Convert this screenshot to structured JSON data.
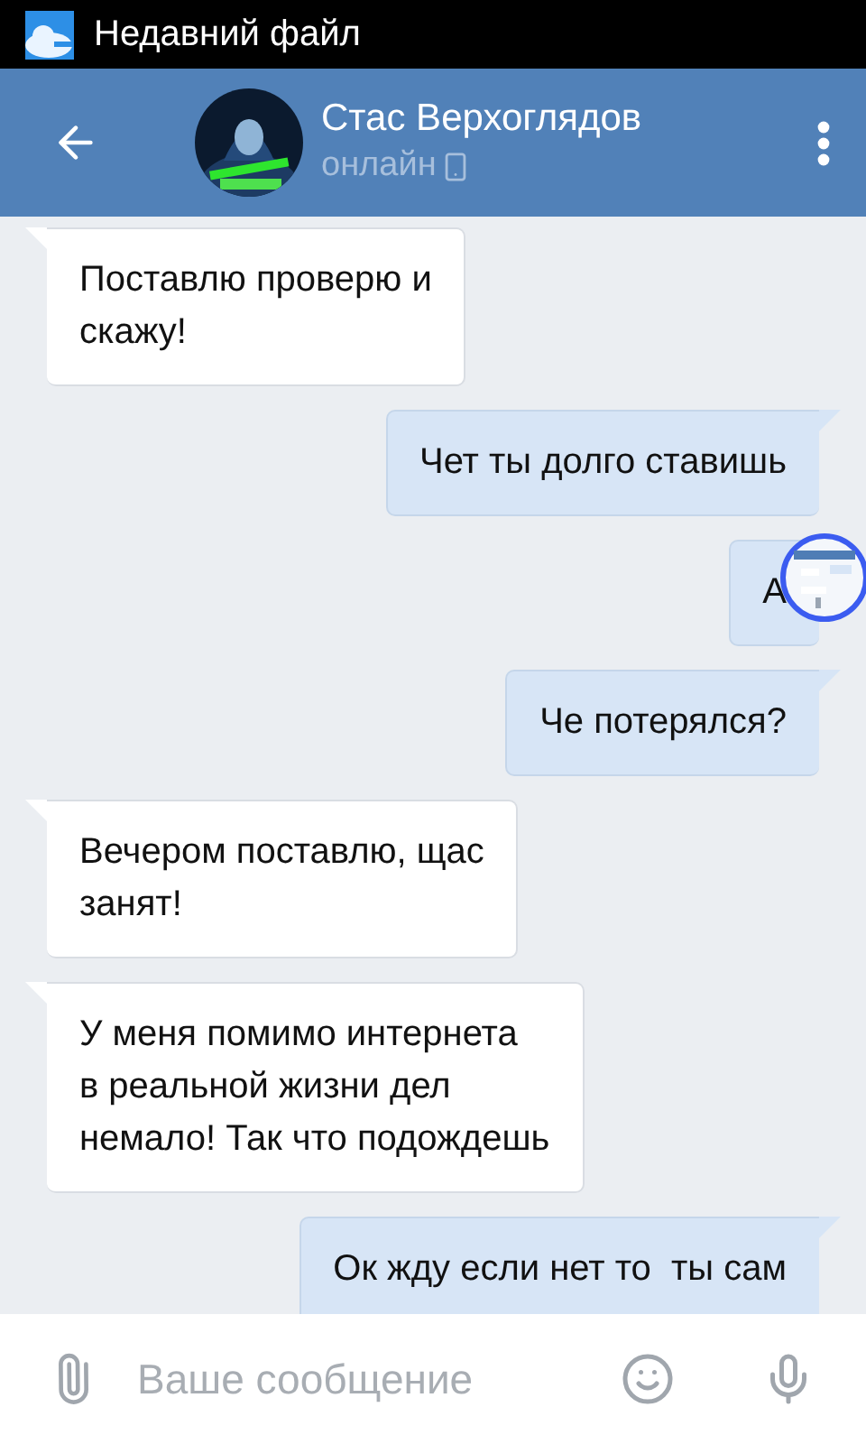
{
  "status_bar": {
    "notification": "Недавний файл"
  },
  "header": {
    "name": "Стас Верхоглядов",
    "status": "онлайн"
  },
  "messages": [
    {
      "text": "Поставлю проверю и\nскажу!",
      "outgoing": false
    },
    {
      "text": "Чет ты долго ставишь",
      "outgoing": true
    },
    {
      "text": "А",
      "outgoing": true,
      "overlay": true
    },
    {
      "text": "Че потерялся?",
      "outgoing": true
    },
    {
      "text": "Вечером поставлю, щас\nзанят!",
      "outgoing": false
    },
    {
      "text": "У меня помимо интернета\nв реальной жизни дел\nнемало! Так что подождешь",
      "outgoing": false
    },
    {
      "text": "Ок жду если нет то  ты сам",
      "outgoing": true
    }
  ],
  "composer": {
    "placeholder": "Ваше сообщение"
  }
}
